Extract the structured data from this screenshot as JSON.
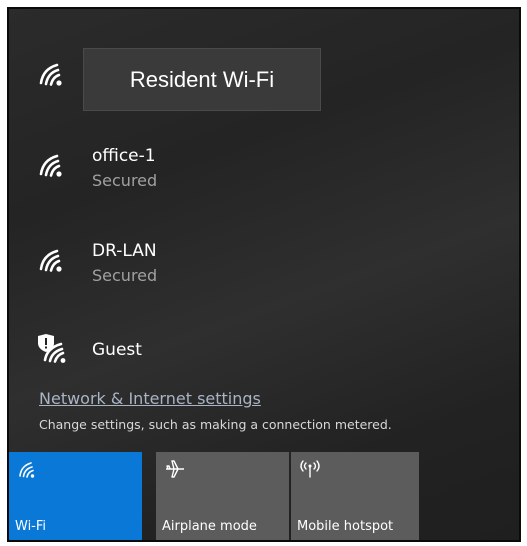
{
  "networks": [
    {
      "name": "Resident Wi-Fi",
      "icon": "wifi-signal-icon"
    },
    {
      "name": "office-1",
      "status": "Secured",
      "icon": "wifi-signal-icon"
    },
    {
      "name": "DR-LAN",
      "status": "Secured",
      "icon": "wifi-signal-icon"
    },
    {
      "name": "Guest",
      "icon": "wifi-shield-icon"
    }
  ],
  "tooltip": {
    "text": "Resident Wi-Fi"
  },
  "settings": {
    "link_label": "Network & Internet settings",
    "description": "Change settings, such as making a connection metered."
  },
  "quick_actions": [
    {
      "label": "Wi-Fi",
      "icon": "wifi-icon",
      "active": true
    },
    {
      "label": "Airplane mode",
      "icon": "airplane-icon",
      "active": false
    },
    {
      "label": "Mobile hotspot",
      "icon": "hotspot-icon",
      "active": false
    }
  ],
  "colors": {
    "accent": "#0a78d7",
    "tile_inactive": "#5c5c5c",
    "status_text": "#a0a0a0",
    "link_text": "#a9b4c4"
  }
}
